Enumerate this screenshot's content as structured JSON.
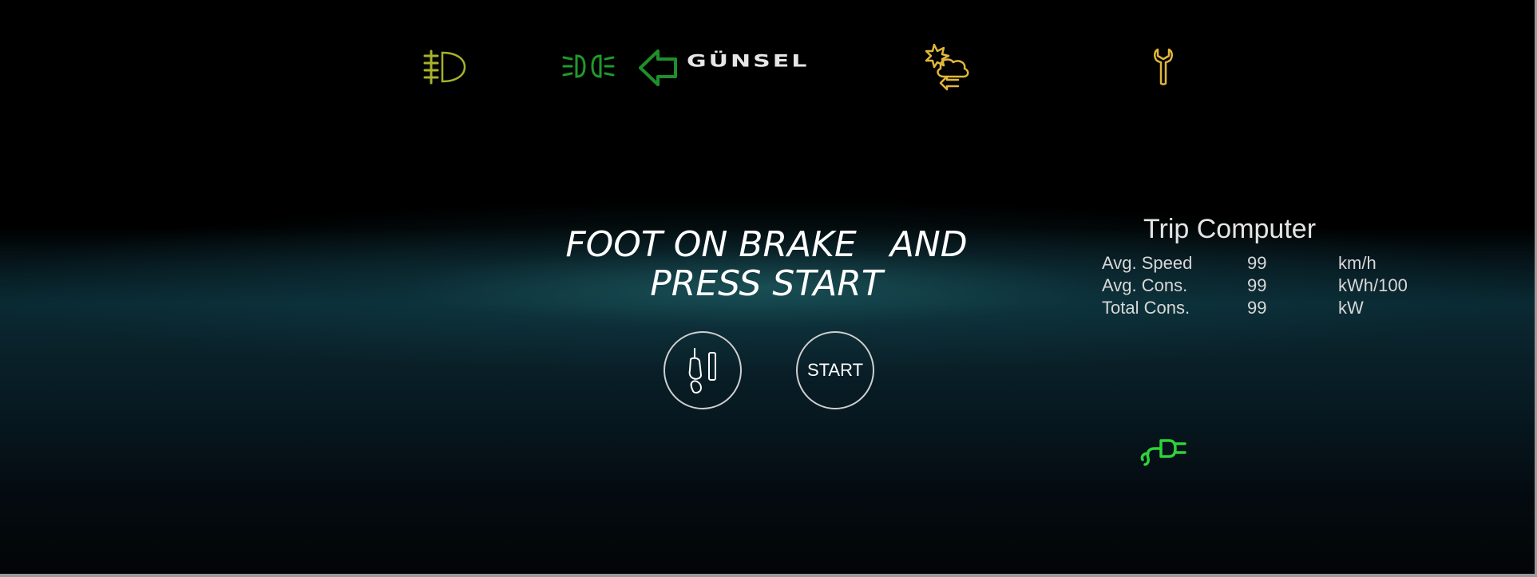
{
  "header": {
    "brand_logo_text": "GÜNSEL",
    "icons": [
      "fog-light-icon",
      "position-lights-icon",
      "brand-arrow-icon",
      "weather-warning-icon",
      "wrench-icon"
    ]
  },
  "instruction": {
    "text": "FOOT ON BRAKE   AND\nPRESS START"
  },
  "controls": {
    "brake_icon": "brake-pedal-icon",
    "start_label": "START"
  },
  "trip_computer": {
    "title": "Trip Computer",
    "rows": [
      {
        "label": "Avg. Speed",
        "value": "99",
        "unit": "km/h"
      },
      {
        "label": "Avg. Cons.",
        "value": "99",
        "unit": "kWh/100"
      },
      {
        "label": "Total Cons.",
        "value": "99",
        "unit": "kW"
      }
    ]
  },
  "status": {
    "charging_icon": "charging-plug-icon"
  },
  "colors": {
    "fog_light": "#a7b22a",
    "position_lights": "#1f9a2a",
    "logo_arrow": "#1f8f2a",
    "weather_warning": "#e0b73a",
    "wrench": "#e0b73a",
    "charging": "#2fd13a",
    "text": "#ffffff"
  }
}
